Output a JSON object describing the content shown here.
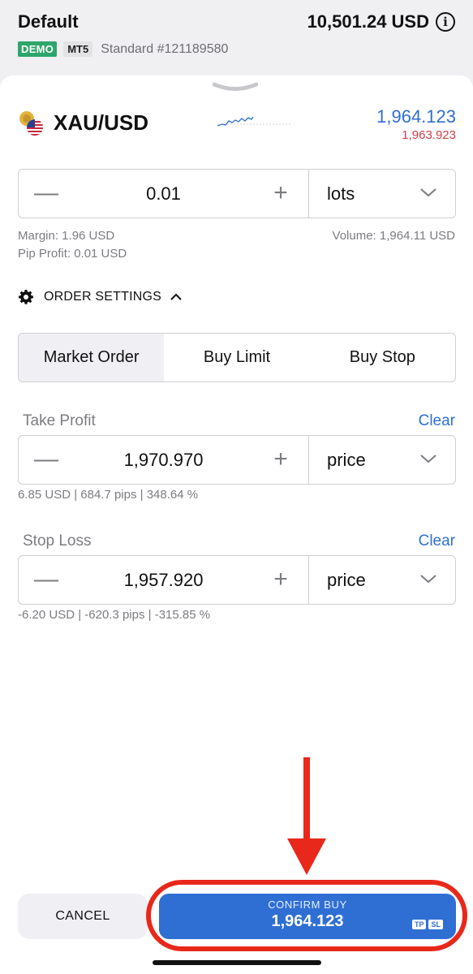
{
  "header": {
    "account_name": "Default",
    "balance": "10,501.24 USD",
    "badge_demo": "DEMO",
    "badge_mt5": "MT5",
    "account_type": "Standard #121189580"
  },
  "symbol": {
    "name": "XAU/USD",
    "ask": "1,964.123",
    "bid": "1,963.923",
    "ask_color": "#2f6fd4",
    "bid_color": "#d33d4a"
  },
  "volume": {
    "value": "0.01",
    "unit": "lots",
    "margin": "Margin: 1.96 USD",
    "pip_profit": "Pip Profit: 0.01 USD",
    "volume_usd": "Volume: 1,964.11 USD"
  },
  "order_settings": {
    "label": "ORDER SETTINGS",
    "tabs": [
      "Market Order",
      "Buy Limit",
      "Buy Stop"
    ],
    "active_tab": "Market Order"
  },
  "take_profit": {
    "label": "Take Profit",
    "clear": "Clear",
    "value": "1,970.970",
    "unit": "price",
    "summary": "6.85 USD | 684.7 pips | 348.64 %"
  },
  "stop_loss": {
    "label": "Stop Loss",
    "clear": "Clear",
    "value": "1,957.920",
    "unit": "price",
    "summary": "-6.20 USD | -620.3 pips | -315.85 %"
  },
  "footer": {
    "cancel": "CANCEL",
    "confirm_title": "CONFIRM BUY",
    "confirm_price": "1,964.123",
    "chip_tp": "TP",
    "chip_sl": "SL",
    "confirm_color": "#2f6fd4",
    "highlight_color": "#e8281a"
  },
  "icons": [
    "info-icon",
    "flag-icon",
    "sparkline",
    "minus-icon",
    "plus-icon",
    "chevron-down-icon",
    "gear-icon",
    "chevron-up-icon",
    "arrow-annotation"
  ]
}
